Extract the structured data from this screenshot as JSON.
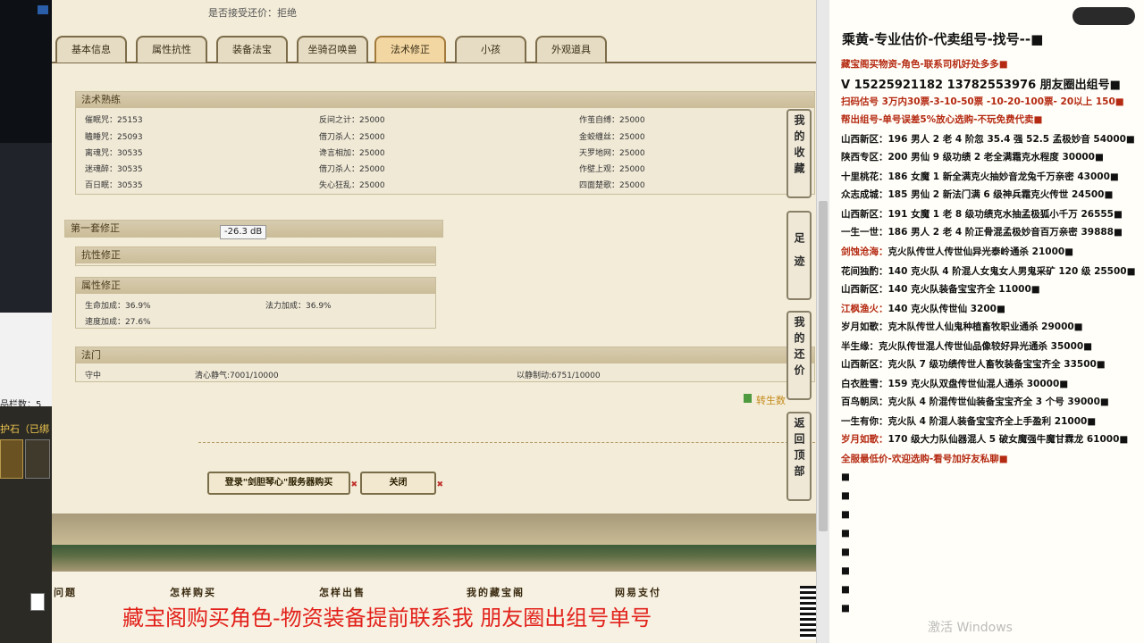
{
  "header": {
    "bargain_label": "是否接受还价：",
    "bargain_value": "拒绝"
  },
  "tabs": [
    {
      "label": "基本信息"
    },
    {
      "label": "属性抗性"
    },
    {
      "label": "装备法宝"
    },
    {
      "label": "坐骑召唤兽"
    },
    {
      "label": "法术修正",
      "active": true
    },
    {
      "label": "小孩"
    },
    {
      "label": "外观道具"
    }
  ],
  "spell_training": {
    "title": "法术熟练",
    "rows": [
      [
        "催眠咒：25153",
        "反间之计：25000",
        "作茧自缚：25000"
      ],
      [
        "瞌睡咒：25093",
        "借刀杀人：25000",
        "金蛟缠丝：25000"
      ],
      [
        "离魂咒：30535",
        "谗言相加：25000",
        "天罗地网：25000"
      ],
      [
        "迷魂醉：30535",
        "借刀杀人：25000",
        "作壁上观：25000"
      ],
      [
        "百日眠：30535",
        "失心狂乱：25000",
        "四面楚歌：25000"
      ]
    ]
  },
  "correction": {
    "title": "第一套修正",
    "resist_title": "抗性修正",
    "attr_title": "属性修正",
    "attr_items": [
      "生命加成：36.9%",
      "法力加成：36.9%",
      "速度加成：27.6%"
    ]
  },
  "faman": {
    "title": "法门",
    "items": [
      "守中",
      "清心静气:7001/10000",
      "以静制动:6751/10000"
    ]
  },
  "tooltip": "-26.3 dB",
  "reborn_label": "转生数",
  "buttons": {
    "login_buy": "登录\"剑胆琴心\"服务器购买",
    "close": "关闭"
  },
  "side_buttons": [
    "我的收藏",
    "足迹",
    "我的还价",
    "返回顶部"
  ],
  "footer": {
    "items": [
      "问题",
      "怎样购买",
      "怎样出售",
      "我的藏宝阁",
      "网易支付"
    ]
  },
  "left_panel": {
    "slots_label": "品栏数：5",
    "stone_label": "护石（已绑"
  },
  "right_panel": {
    "title": "乘黄-专业估价-代卖组号-找号--■",
    "lines": [
      {
        "text": "藏宝阁买物资-角色-联系司机好处多多■",
        "color": "red"
      },
      {
        "text": "V 15225921182  13782553976 朋友圈出组号■",
        "color": "black",
        "big": true
      },
      {
        "text": "扫码估号 3万内30票-3-10-50票 -10-20-100票- 20以上 150■",
        "color": "red"
      },
      {
        "text": "帮出组号-单号误差5%放心选购-不玩免费代卖■",
        "color": "red"
      },
      {
        "label": "山西新区：",
        "text": "196 男人 2 老 4 阶忽 35.4 强 52.5 孟极妙音 54000■"
      },
      {
        "label": "陕西专区：",
        "text": "200 男仙 9 级功绩 2 老全满霜克水程度 30000■"
      },
      {
        "label": "十里桃花：",
        "text": "186 女魔 1 新全满克火抽妙音龙兔千万亲密 43000■"
      },
      {
        "label": "众志成城：",
        "text": "185 男仙 2 新法门满 6 级神兵霜克火传世 24500■"
      },
      {
        "label": "山西新区：",
        "text": "191 女魔 1 老 8 级功绩克水抽孟极狐小千万 26555■"
      },
      {
        "label": "一生一世：",
        "text": "186 男人 2 老 4 阶正骨混孟极妙音百万亲密 39888■"
      },
      {
        "label": "剑蚀沧海：",
        "text": "克火队传世人传世仙异光泰岭通杀 21000■",
        "hl": true
      },
      {
        "label": "花间独酌：",
        "text": "140 克火队 4 阶混人女鬼女人男鬼采矿 120 级 25500■"
      },
      {
        "label": "山西新区：",
        "text": "140 克火队装备宝宝齐全 11000■"
      },
      {
        "label": "江枫渔火：",
        "text": "140 克火队传世仙 3200■",
        "hl": true
      },
      {
        "label": "岁月如歌：",
        "text": "克木队传世人仙鬼种植畜牧职业通杀 29000■"
      },
      {
        "label": "半生缘：",
        "text": "克火队传世混人传世仙品像较好异光通杀 35000■"
      },
      {
        "label": "山西新区：",
        "text": "克火队 7 级功绩传世人畜牧装备宝宝齐全 33500■"
      },
      {
        "label": "白衣胜雪：",
        "text": "159 克火队双盘传世仙混人通杀 30000■"
      },
      {
        "label": "百鸟朝凤：",
        "text": "克火队 4 阶混传世仙装备宝宝齐全 3 个号 39000■"
      },
      {
        "label": "一生有你：",
        "text": "克火队 4 阶混人装备宝宝齐全上手盈利 21000■"
      },
      {
        "label": "岁月如歌：",
        "text": "170 级大力队仙器混人 5 破女魔强牛魔甘霖龙 61000■",
        "hl": true
      },
      {
        "text": "全服最低价-欢迎选购-看号加好友私聊■",
        "color": "red"
      }
    ]
  },
  "caption": "藏宝阁购买角色-物资装备提前联系我    朋友圈出组号单号",
  "watermark": "激活 Windows",
  "colors": {
    "accent_red": "#e2211b",
    "tab_active": "#f3d7a2",
    "panel_bg": "#f3ecd8"
  }
}
